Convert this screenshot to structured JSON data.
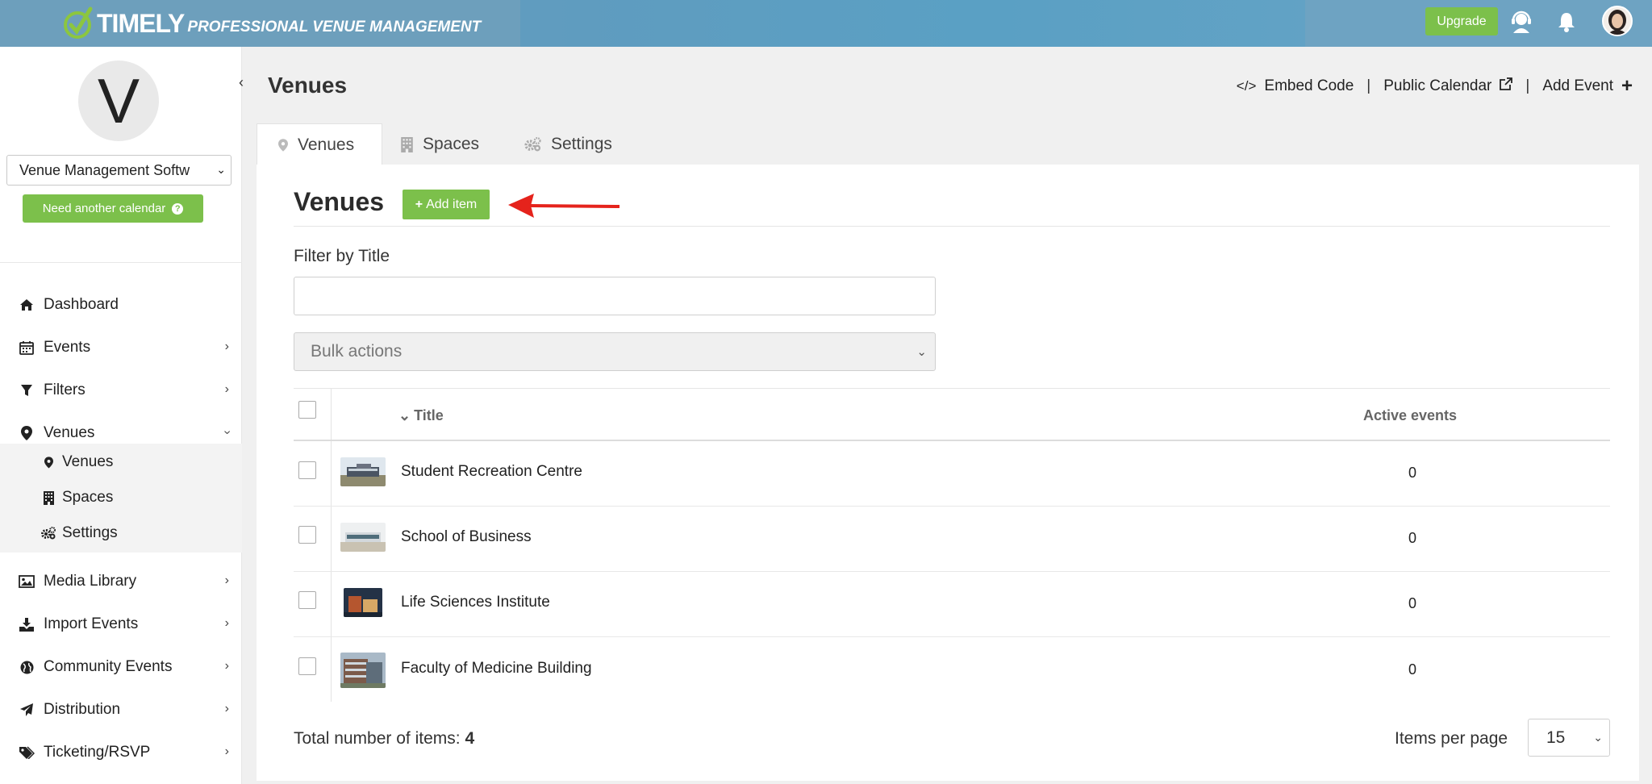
{
  "topbar": {
    "logo_text": "TIMELY",
    "tagline": "PROFESSIONAL VENUE MANAGEMENT",
    "upgrade_label": "Upgrade",
    "colors": {
      "accent_green": "#7cc04b",
      "bar_blue": "#5fa0c2"
    }
  },
  "sidebar": {
    "avatar_letter": "V",
    "calendar_select_value": "Venue Management Softw",
    "need_calendar_label": "Need another calendar",
    "nav": [
      {
        "label": "Dashboard",
        "icon": "home-icon"
      },
      {
        "label": "Events",
        "icon": "calendar-icon"
      },
      {
        "label": "Filters",
        "icon": "filter-icon"
      },
      {
        "label": "Venues",
        "icon": "map-pin-icon"
      },
      {
        "label": "Media Library",
        "icon": "image-icon"
      },
      {
        "label": "Import Events",
        "icon": "download-icon"
      },
      {
        "label": "Community Events",
        "icon": "globe-icon"
      },
      {
        "label": "Distribution",
        "icon": "paper-plane-icon"
      },
      {
        "label": "Ticketing/RSVP",
        "icon": "tag-icon"
      }
    ],
    "subnav": [
      {
        "label": "Venues",
        "icon": "map-pin-icon"
      },
      {
        "label": "Spaces",
        "icon": "building-icon"
      },
      {
        "label": "Settings",
        "icon": "cogs-icon"
      }
    ]
  },
  "header": {
    "title": "Venues",
    "embed_code": "Embed Code",
    "public_calendar": "Public Calendar",
    "add_event": "Add Event",
    "sep": "|"
  },
  "tabs": [
    {
      "label": "Venues",
      "icon": "map-pin-icon",
      "active": true
    },
    {
      "label": "Spaces",
      "icon": "building-icon",
      "active": false
    },
    {
      "label": "Settings",
      "icon": "cogs-icon",
      "active": false
    }
  ],
  "panel": {
    "title": "Venues",
    "add_item_label": "Add item",
    "filter_label": "Filter by Title",
    "filter_value": "",
    "bulk_actions": "Bulk actions"
  },
  "table": {
    "columns": {
      "title": "Title",
      "active_events": "Active events"
    },
    "rows": [
      {
        "title": "Student Recreation Centre",
        "active_events": "0"
      },
      {
        "title": "School of Business",
        "active_events": "0"
      },
      {
        "title": "Life Sciences Institute",
        "active_events": "0"
      },
      {
        "title": "Faculty of Medicine Building",
        "active_events": "0"
      }
    ]
  },
  "footer": {
    "total_label": "Total number of items:",
    "total_value": "4",
    "items_per_page_label": "Items per page",
    "items_per_page_value": "15"
  }
}
